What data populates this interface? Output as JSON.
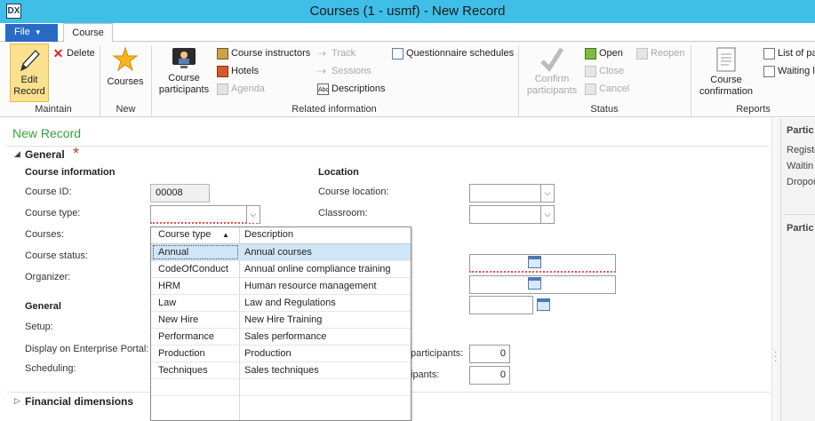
{
  "window": {
    "title": "Courses (1 - usmf) - New Record"
  },
  "tabs": {
    "file": "File",
    "course": "Course"
  },
  "ribbon": {
    "maintain": {
      "label": "Maintain",
      "edit_line1": "Edit",
      "edit_line2": "Record",
      "delete": "Delete"
    },
    "new": {
      "label": "New",
      "courses": "Courses"
    },
    "related": {
      "label": "Related information",
      "course_participants_line1": "Course",
      "course_participants_line2": "participants",
      "course_instructors": "Course instructors",
      "hotels": "Hotels",
      "agenda": "Agenda",
      "track": "Track",
      "sessions": "Sessions",
      "descriptions": "Descriptions",
      "questionnaire_schedules": "Questionnaire schedules"
    },
    "status": {
      "label": "Status",
      "confirm_line1": "Confirm",
      "confirm_line2": "participants",
      "open": "Open",
      "close": "Close",
      "cancel": "Cancel",
      "reopen": "Reopen"
    },
    "reports": {
      "label": "Reports",
      "confirmation_line1": "Course",
      "confirmation_line2": "confirmation",
      "list_of": "List of pa",
      "waiting": "Waiting l"
    }
  },
  "page": {
    "title": "New Record"
  },
  "general": {
    "heading": "General",
    "course_info_heading": "Course information",
    "course_id_label": "Course ID:",
    "course_id_value": "00008",
    "course_type_label": "Course type:",
    "courses_label": "Courses:",
    "course_status_label": "Course status:",
    "organizer_label": "Organizer:",
    "general_sub_heading": "General",
    "setup_label": "Setup:",
    "portal_label": "Display on Enterprise Portal:",
    "scheduling_label": "Scheduling:",
    "location_heading": "Location",
    "course_location_label": "Course location:",
    "classroom_label": "Classroom:",
    "max_participants_label": "participants:",
    "max_participants_value": "0",
    "participants_label": "ipants:",
    "participants_value": "0"
  },
  "financial": {
    "heading": "Financial dimensions"
  },
  "lookup": {
    "col1": "Course type",
    "col2": "Description",
    "rows": [
      {
        "type": "Annual",
        "desc": "Annual courses"
      },
      {
        "type": "CodeOfConduct",
        "desc": "Annual online compliance training"
      },
      {
        "type": "HRM",
        "desc": "Human resource management"
      },
      {
        "type": "Law",
        "desc": "Law and Regulations"
      },
      {
        "type": "New Hire",
        "desc": "New Hire Training"
      },
      {
        "type": "Performance",
        "desc": "Sales performance"
      },
      {
        "type": "Production",
        "desc": "Production"
      },
      {
        "type": "Techniques",
        "desc": "Sales techniques"
      }
    ]
  },
  "rightpanel": {
    "heading1": "Partic",
    "registered": "Registe",
    "waiting": "Waitin",
    "dropout": "Dropou",
    "heading2": "Partic"
  },
  "colors": {
    "titlebar": "#3fbfe8",
    "file_tab": "#2a6ac7",
    "page_title": "#3aa13a",
    "required": "#c0392b"
  }
}
